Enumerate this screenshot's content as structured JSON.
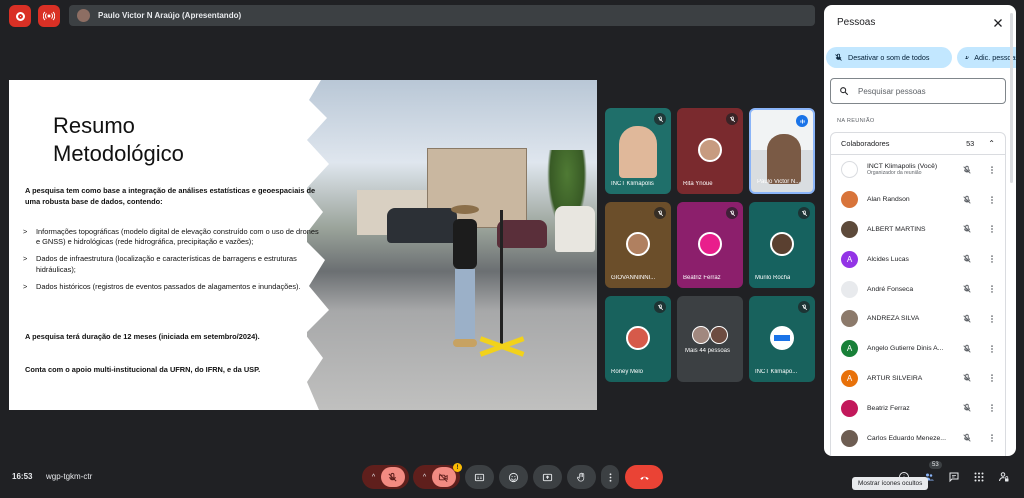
{
  "top_bar": {
    "presenter_label": "Paulo Victor N Araújo (Apresentando)"
  },
  "slide": {
    "heading": "Resumo\nMetodológico",
    "intro": "A pesquisa tem como base a integração de análises estatísticas e geoespaciais de uma robusta base de dados, contendo:",
    "bullets": [
      "Informações topográficas (modelo digital de elevação construído com o uso de drones e GNSS) e hidrológicas (rede hidrográfica, precipitação e vazões);",
      "Dados de infraestrutura (localização e características de barragens e estruturas  hidráulicas);",
      "Dados históricos (registros de eventos passados de alagamentos e inundações)."
    ],
    "duration": "A pesquisa terá duração de 12 meses (iniciada em setembro/2024).",
    "support": "Conta com o apoio multi-institucional da UFRN, do IFRN, e da USP."
  },
  "tiles": [
    {
      "name": "INCT Klimapolis",
      "bg": "#1f6f6a",
      "mic": "muted"
    },
    {
      "name": "Rita Ynoue",
      "bg": "#7a2a2e",
      "mic": "muted"
    },
    {
      "name": "Paulo Victor N...",
      "bg": "#d9dde0",
      "mic": "speaking"
    },
    {
      "name": "GIOVANNINNI...",
      "bg": "#6b4e2a",
      "mic": "muted"
    },
    {
      "name": "Beatriz Ferraz",
      "bg": "#8c1f6c",
      "mic": "muted"
    },
    {
      "name": "Murilo Rocha",
      "bg": "#16625f",
      "mic": "muted"
    },
    {
      "name": "Roney Melo",
      "bg": "#18625d",
      "mic": "muted"
    },
    {
      "name": "Mais 44 pessoas",
      "bg": "#3c4043",
      "mic": "none"
    },
    {
      "name": "INCT Klimapo...",
      "bg": "#18625d",
      "mic": "muted"
    }
  ],
  "bottom_bar": {
    "time": "16:53",
    "meeting_code": "wgp-tgkm-ctr",
    "camera_badge": "!",
    "people_count": "53",
    "tooltip": "Mostrar ícones ocultos"
  },
  "panel": {
    "title": "Pessoas",
    "mute_all_label": "Desativar o som de todos",
    "add_people_label": "Adic. pessoas",
    "search_placeholder": "Pesquisar pessoas",
    "section_label": "NA REUNIÃO",
    "group_label": "Colaboradores",
    "group_count": "53",
    "people": [
      {
        "name": "INCT Klimapolis (Você)",
        "sub": "Organizador da reunião",
        "initial": "",
        "color": "#ffffff"
      },
      {
        "name": "Alan Randson",
        "sub": "",
        "initial": "",
        "color": "#d8743a"
      },
      {
        "name": "ALBERT MARTINS",
        "sub": "",
        "initial": "",
        "color": "#5d4a3a"
      },
      {
        "name": "Alcides Lucas",
        "sub": "",
        "initial": "A",
        "color": "#9334e6"
      },
      {
        "name": "André Fonseca",
        "sub": "",
        "initial": "",
        "color": "#e8eaed"
      },
      {
        "name": "ANDREZA SILVA",
        "sub": "",
        "initial": "",
        "color": "#8c7a6b"
      },
      {
        "name": "Angelo Gutierre Dinis A...",
        "sub": "",
        "initial": "A",
        "color": "#188038"
      },
      {
        "name": "ARTUR SILVEIRA",
        "sub": "",
        "initial": "A",
        "color": "#e8710a"
      },
      {
        "name": "Beatriz Ferraz",
        "sub": "",
        "initial": "",
        "color": "#c2185b"
      },
      {
        "name": "Carlos Eduardo Meneze...",
        "sub": "",
        "initial": "",
        "color": "#6d5d52"
      }
    ]
  }
}
